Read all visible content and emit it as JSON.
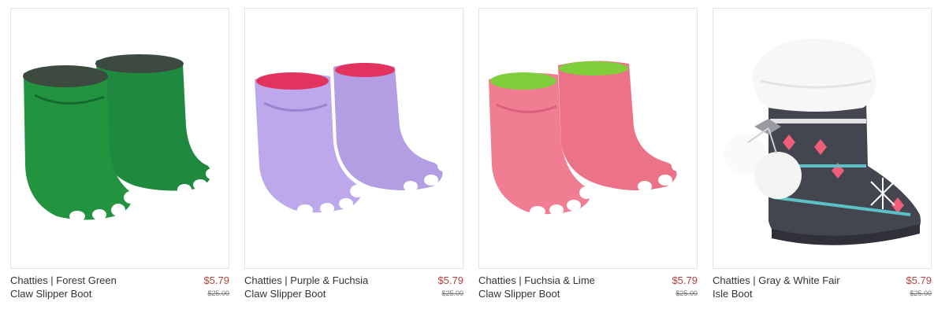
{
  "products": [
    {
      "name_line1": "Chatties | Forest Green",
      "name_line2": "Claw Slipper Boot",
      "price": "$5.79",
      "original_price": "$25.00",
      "image": "green-claw-slipper-boot",
      "colors": {
        "body": "#1f8a3f",
        "shade": "#156b2f",
        "lining": "#3d4a3f",
        "toe": "#ffffff"
      }
    },
    {
      "name_line1": "Chatties | Purple & Fuchsia",
      "name_line2": "Claw Slipper Boot",
      "price": "$5.79",
      "original_price": "$25.00",
      "image": "purple-claw-slipper-boot",
      "colors": {
        "body": "#b7a2e6",
        "shade": "#9a84d1",
        "lining": "#e2335f",
        "toe": "#ffffff"
      }
    },
    {
      "name_line1": "Chatties | Fuchsia & Lime",
      "name_line2": "Claw Slipper Boot",
      "price": "$5.79",
      "original_price": "$25.00",
      "image": "pink-claw-slipper-boot",
      "colors": {
        "body": "#ef7a8f",
        "shade": "#d9627a",
        "lining": "#7fcf3a",
        "toe": "#ffffff"
      }
    },
    {
      "name_line1": "Chatties | Gray & White Fair",
      "name_line2": "Isle Boot",
      "price": "$5.79",
      "original_price": "$25.00",
      "image": "gray-fair-isle-boot",
      "colors": {
        "body": "#44464f",
        "cuff": "#f5f5f5",
        "pattern_pink": "#ef5f7a",
        "pattern_teal": "#5bc1c6",
        "pattern_white": "#ffffff"
      }
    }
  ]
}
